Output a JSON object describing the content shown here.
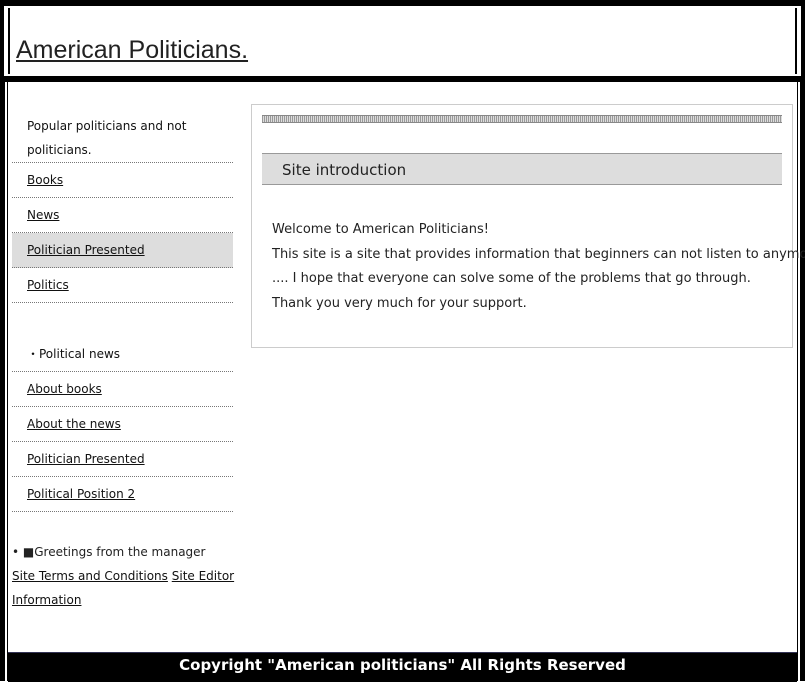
{
  "header": {
    "title": "American Politicians."
  },
  "sidebar": {
    "intro": "Popular politicians and not politicians.",
    "items": [
      {
        "label": "Books"
      },
      {
        "label": "News"
      },
      {
        "label": "Politician Presented",
        "active": true
      },
      {
        "label": "Politics"
      }
    ],
    "news_heading": "・Political news",
    "news_items": [
      {
        "label": "About books"
      },
      {
        "label": "About the news"
      },
      {
        "label": "Politician Presented"
      },
      {
        "label": "Political Position 2"
      }
    ]
  },
  "footer_links": {
    "greeting": "■Greetings from the manager",
    "terms": "Site Terms and Conditions",
    "editor": "Site Editor Information"
  },
  "main": {
    "section_title": "Site introduction",
    "paragraphs": [
      "Welcome to American Politicians!",
      "This site is a site that provides information that beginners can not listen to anymore",
      ".... I hope that everyone can solve some of the problems that go through.",
      "Thank you very much for your support."
    ]
  },
  "footer": {
    "copyright": "Copyright \"American politicians\" All Rights Reserved"
  },
  "colors": {
    "border": "#000000",
    "active_bg": "#dddddd",
    "footer_bg": "#000000"
  }
}
